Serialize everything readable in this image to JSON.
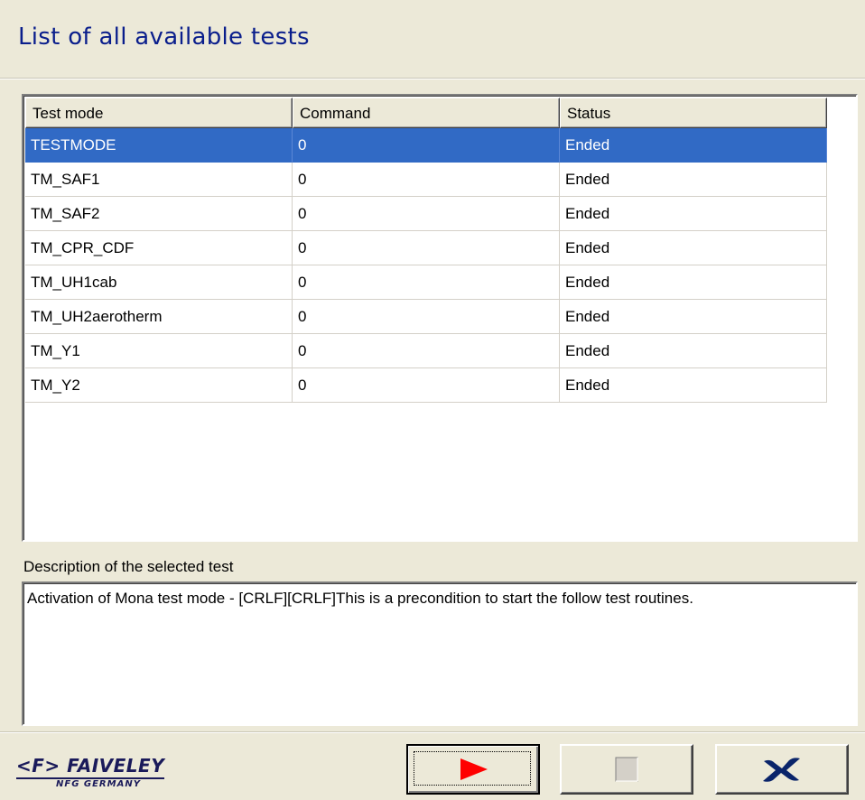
{
  "header": {
    "title": "List of all available tests"
  },
  "table": {
    "columns": [
      "Test mode",
      "Command",
      "Status"
    ],
    "rows": [
      [
        "TESTMODE",
        "0",
        "Ended"
      ],
      [
        "TM_SAF1",
        "0",
        "Ended"
      ],
      [
        "TM_SAF2",
        "0",
        "Ended"
      ],
      [
        "TM_CPR_CDF",
        "0",
        "Ended"
      ],
      [
        "TM_UH1cab",
        "0",
        "Ended"
      ],
      [
        "TM_UH2aerotherm",
        "0",
        "Ended"
      ],
      [
        "TM_Y1",
        "0",
        "Ended"
      ],
      [
        "TM_Y2",
        "0",
        "Ended"
      ]
    ],
    "selected_row": 0
  },
  "description": {
    "label": "Description of the selected test",
    "text": "Activation of Mona test mode - [CRLF][CRLF]This is a precondition to start the follow test routines."
  },
  "logo": {
    "main": "<F> FAIVELEY",
    "sub": "NFG GERMANY"
  },
  "buttons": {
    "run_icon": "play-icon",
    "stop_icon": "stop-icon",
    "close_icon": "close-x-icon"
  },
  "colors": {
    "title": "#0a1e8c",
    "selection": "#316ac5",
    "run_icon": "#ff0000",
    "close_icon": "#0a246a",
    "stop_icon_disabled": "#d4d0c8"
  }
}
